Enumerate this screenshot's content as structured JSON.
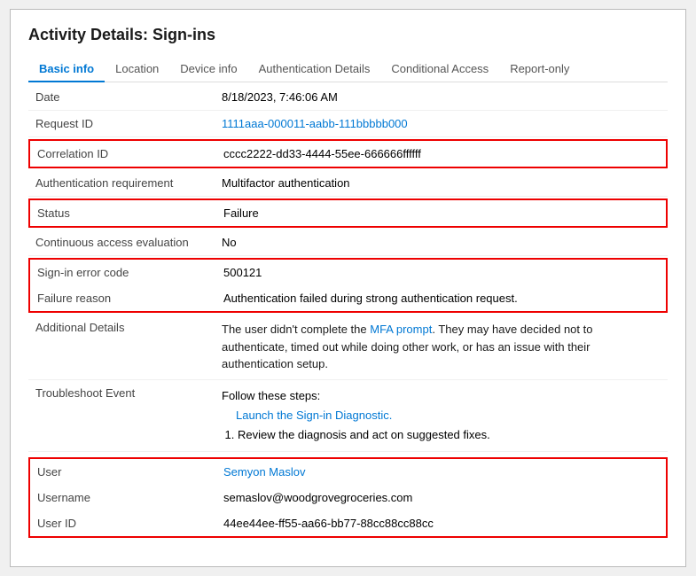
{
  "page": {
    "title": "Activity Details: Sign-ins"
  },
  "tabs": [
    {
      "label": "Basic info",
      "active": true
    },
    {
      "label": "Location",
      "active": false
    },
    {
      "label": "Device info",
      "active": false
    },
    {
      "label": "Authentication Details",
      "active": false
    },
    {
      "label": "Conditional Access",
      "active": false
    },
    {
      "label": "Report-only",
      "active": false
    }
  ],
  "rows": {
    "date_label": "Date",
    "date_value": "8/18/2023, 7:46:06 AM",
    "request_id_label": "Request ID",
    "request_id_value": "1111aaa-000011-aabb-111bbbbb000",
    "correlation_id_label": "Correlation ID",
    "correlation_id_value": "cccc2222-dd33-4444-55ee-666666ffffff",
    "auth_req_label": "Authentication requirement",
    "auth_req_value": "Multifactor authentication",
    "status_label": "Status",
    "status_value": "Failure",
    "continuous_label": "Continuous access evaluation",
    "continuous_value": "No",
    "sign_in_error_label": "Sign-in error code",
    "sign_in_error_value": "500121",
    "failure_reason_label": "Failure reason",
    "failure_reason_value": "Authentication failed during strong authentication request.",
    "additional_details_label": "Additional Details",
    "additional_details_part1": "The user didn't complete the ",
    "additional_details_link": "MFA prompt",
    "additional_details_part2": ". They may have decided not to authenticate, timed out while doing other work, or has an issue with their authentication setup.",
    "troubleshoot_label": "Troubleshoot Event",
    "troubleshoot_follow": "Follow these steps:",
    "troubleshoot_link": "Launch the Sign-in Diagnostic.",
    "troubleshoot_step1": "Review the diagnosis and act on suggested fixes.",
    "user_label": "User",
    "user_value": "Semyon Maslov",
    "username_label": "Username",
    "username_value": "semaslov@woodgrovegroceries.com",
    "user_id_label": "User ID",
    "user_id_value": "44ee44ee-ff55-aa66-bb77-88cc88cc88cc"
  }
}
